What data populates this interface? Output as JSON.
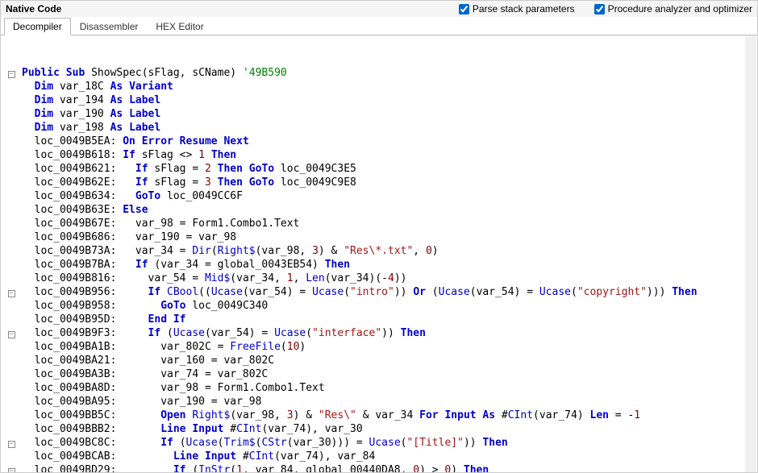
{
  "header": {
    "title": "Native Code",
    "checkboxes": [
      {
        "label": "Parse stack parameters",
        "checked": true
      },
      {
        "label": "Procedure analyzer and optimizer",
        "checked": true
      }
    ]
  },
  "tabs": [
    {
      "label": "Decompiler",
      "active": true
    },
    {
      "label": "Disassembler",
      "active": false
    },
    {
      "label": "HEX Editor",
      "active": false
    }
  ],
  "code": [
    {
      "fold": "minus",
      "indent": 0,
      "tokens": [
        [
          "k-blue",
          "Public Sub "
        ],
        [
          "k-plain",
          "ShowSpec(sFlag, sCName) "
        ],
        [
          "k-cmt",
          "'49B590"
        ]
      ]
    },
    {
      "indent": 1,
      "tokens": [
        [
          "k-blue",
          "Dim "
        ],
        [
          "k-plain",
          "var_18C "
        ],
        [
          "k-blue",
          "As Variant"
        ]
      ]
    },
    {
      "indent": 1,
      "tokens": [
        [
          "k-blue",
          "Dim "
        ],
        [
          "k-plain",
          "var_194 "
        ],
        [
          "k-blue",
          "As Label"
        ]
      ]
    },
    {
      "indent": 1,
      "tokens": [
        [
          "k-blue",
          "Dim "
        ],
        [
          "k-plain",
          "var_190 "
        ],
        [
          "k-blue",
          "As Label"
        ]
      ]
    },
    {
      "indent": 1,
      "tokens": [
        [
          "k-blue",
          "Dim "
        ],
        [
          "k-plain",
          "var_198 "
        ],
        [
          "k-blue",
          "As Label"
        ]
      ]
    },
    {
      "indent": 1,
      "tokens": [
        [
          "k-plain",
          "loc_0049B5EA: "
        ],
        [
          "k-blue",
          "On Error Resume Next"
        ]
      ]
    },
    {
      "indent": 1,
      "tokens": [
        [
          "k-plain",
          "loc_0049B618: "
        ],
        [
          "k-blue",
          "If "
        ],
        [
          "k-plain",
          "sFlag <> "
        ],
        [
          "k-num",
          "1"
        ],
        [
          "k-blue",
          " Then"
        ]
      ]
    },
    {
      "indent": 1,
      "tokens": [
        [
          "k-plain",
          "loc_0049B621:   "
        ],
        [
          "k-blue",
          "If "
        ],
        [
          "k-plain",
          "sFlag = "
        ],
        [
          "k-num",
          "2"
        ],
        [
          "k-blue",
          " Then GoTo "
        ],
        [
          "k-plain",
          "loc_0049C3E5"
        ]
      ]
    },
    {
      "indent": 1,
      "tokens": [
        [
          "k-plain",
          "loc_0049B62E:   "
        ],
        [
          "k-blue",
          "If "
        ],
        [
          "k-plain",
          "sFlag = "
        ],
        [
          "k-num",
          "3"
        ],
        [
          "k-blue",
          " Then GoTo "
        ],
        [
          "k-plain",
          "loc_0049C9E8"
        ]
      ]
    },
    {
      "indent": 1,
      "tokens": [
        [
          "k-plain",
          "loc_0049B634:   "
        ],
        [
          "k-blue",
          "GoTo "
        ],
        [
          "k-plain",
          "loc_0049CC6F"
        ]
      ]
    },
    {
      "indent": 1,
      "tokens": [
        [
          "k-plain",
          "loc_0049B63E: "
        ],
        [
          "k-blue",
          "Else"
        ]
      ]
    },
    {
      "indent": 1,
      "tokens": [
        [
          "k-plain",
          "loc_0049B67E:   var_98 = Form1.Combo1.Text"
        ]
      ]
    },
    {
      "indent": 1,
      "tokens": [
        [
          "k-plain",
          "loc_0049B686:   var_190 = var_98"
        ]
      ]
    },
    {
      "indent": 1,
      "tokens": [
        [
          "k-plain",
          "loc_0049B73A:   var_34 = "
        ],
        [
          "k-bluep",
          "Dir"
        ],
        [
          "k-plain",
          "("
        ],
        [
          "k-bluep",
          "Right$"
        ],
        [
          "k-plain",
          "(var_98, "
        ],
        [
          "k-num",
          "3"
        ],
        [
          "k-plain",
          ") & "
        ],
        [
          "k-str",
          "\"Res\\*.txt\""
        ],
        [
          "k-plain",
          ", "
        ],
        [
          "k-num",
          "0"
        ],
        [
          "k-plain",
          ")"
        ]
      ]
    },
    {
      "indent": 1,
      "tokens": [
        [
          "k-plain",
          "loc_0049B7BA:   "
        ],
        [
          "k-blue",
          "If "
        ],
        [
          "k-plain",
          "(var_34 = global_0043EB54) "
        ],
        [
          "k-blue",
          "Then"
        ]
      ]
    },
    {
      "indent": 1,
      "tokens": [
        [
          "k-plain",
          "loc_0049B816:     var_54 = "
        ],
        [
          "k-bluep",
          "Mid$"
        ],
        [
          "k-plain",
          "(var_34, "
        ],
        [
          "k-num",
          "1"
        ],
        [
          "k-plain",
          ", "
        ],
        [
          "k-bluep",
          "Len"
        ],
        [
          "k-plain",
          "(var_34)(-"
        ],
        [
          "k-num",
          "4"
        ],
        [
          "k-plain",
          "))"
        ]
      ]
    },
    {
      "fold": "minus",
      "indent": 1,
      "tokens": [
        [
          "k-plain",
          "loc_0049B956:     "
        ],
        [
          "k-blue",
          "If "
        ],
        [
          "k-bluep",
          "CBool"
        ],
        [
          "k-plain",
          "(("
        ],
        [
          "k-bluep",
          "Ucase"
        ],
        [
          "k-plain",
          "(var_54) = "
        ],
        [
          "k-bluep",
          "Ucase"
        ],
        [
          "k-plain",
          "("
        ],
        [
          "k-str",
          "\"intro\""
        ],
        [
          "k-plain",
          ")) "
        ],
        [
          "k-blue",
          "Or "
        ],
        [
          "k-plain",
          "("
        ],
        [
          "k-bluep",
          "Ucase"
        ],
        [
          "k-plain",
          "(var_54) = "
        ],
        [
          "k-bluep",
          "Ucase"
        ],
        [
          "k-plain",
          "("
        ],
        [
          "k-str",
          "\"copyright\""
        ],
        [
          "k-plain",
          "))) "
        ],
        [
          "k-blue",
          "Then"
        ]
      ]
    },
    {
      "indent": 1,
      "tokens": [
        [
          "k-plain",
          "loc_0049B958:       "
        ],
        [
          "k-blue",
          "GoTo "
        ],
        [
          "k-plain",
          "loc_0049C340"
        ]
      ]
    },
    {
      "indent": 1,
      "tokens": [
        [
          "k-plain",
          "loc_0049B95D:     "
        ],
        [
          "k-blue",
          "End If"
        ]
      ]
    },
    {
      "fold": "minus",
      "indent": 1,
      "tokens": [
        [
          "k-plain",
          "loc_0049B9F3:     "
        ],
        [
          "k-blue",
          "If "
        ],
        [
          "k-plain",
          "("
        ],
        [
          "k-bluep",
          "Ucase"
        ],
        [
          "k-plain",
          "(var_54) = "
        ],
        [
          "k-bluep",
          "Ucase"
        ],
        [
          "k-plain",
          "("
        ],
        [
          "k-str",
          "\"interface\""
        ],
        [
          "k-plain",
          ")) "
        ],
        [
          "k-blue",
          "Then"
        ]
      ]
    },
    {
      "indent": 1,
      "tokens": [
        [
          "k-plain",
          "loc_0049BA1B:       var_802C = "
        ],
        [
          "k-bluep",
          "FreeFile"
        ],
        [
          "k-plain",
          "("
        ],
        [
          "k-num",
          "10"
        ],
        [
          "k-plain",
          ")"
        ]
      ]
    },
    {
      "indent": 1,
      "tokens": [
        [
          "k-plain",
          "loc_0049BA21:       var_160 = var_802C"
        ]
      ]
    },
    {
      "indent": 1,
      "tokens": [
        [
          "k-plain",
          "loc_0049BA3B:       var_74 = var_802C"
        ]
      ]
    },
    {
      "indent": 1,
      "tokens": [
        [
          "k-plain",
          "loc_0049BA8D:       var_98 = Form1.Combo1.Text"
        ]
      ]
    },
    {
      "indent": 1,
      "tokens": [
        [
          "k-plain",
          "loc_0049BA95:       var_190 = var_98"
        ]
      ]
    },
    {
      "indent": 1,
      "tokens": [
        [
          "k-plain",
          "loc_0049BB5C:       "
        ],
        [
          "k-blue",
          "Open "
        ],
        [
          "k-bluep",
          "Right$"
        ],
        [
          "k-plain",
          "(var_98, "
        ],
        [
          "k-num",
          "3"
        ],
        [
          "k-plain",
          ") & "
        ],
        [
          "k-str",
          "\"Res\\\""
        ],
        [
          "k-plain",
          " & var_34 "
        ],
        [
          "k-blue",
          "For Input As "
        ],
        [
          "k-plain",
          "#"
        ],
        [
          "k-bluep",
          "CInt"
        ],
        [
          "k-plain",
          "(var_74) "
        ],
        [
          "k-blue",
          "Len"
        ],
        [
          "k-plain",
          " = -"
        ],
        [
          "k-num",
          "1"
        ]
      ]
    },
    {
      "indent": 1,
      "tokens": [
        [
          "k-plain",
          "loc_0049BBB2:       "
        ],
        [
          "k-blue",
          "Line Input "
        ],
        [
          "k-plain",
          "#"
        ],
        [
          "k-bluep",
          "CInt"
        ],
        [
          "k-plain",
          "(var_74), var_30"
        ]
      ]
    },
    {
      "fold": "minus",
      "indent": 1,
      "tokens": [
        [
          "k-plain",
          "loc_0049BC8C:       "
        ],
        [
          "k-blue",
          "If "
        ],
        [
          "k-plain",
          "("
        ],
        [
          "k-bluep",
          "Ucase"
        ],
        [
          "k-plain",
          "("
        ],
        [
          "k-bluep",
          "Trim$"
        ],
        [
          "k-plain",
          "("
        ],
        [
          "k-bluep",
          "CStr"
        ],
        [
          "k-plain",
          "(var_30))) = "
        ],
        [
          "k-bluep",
          "Ucase"
        ],
        [
          "k-plain",
          "("
        ],
        [
          "k-str",
          "\"[Title]\""
        ],
        [
          "k-plain",
          ")) "
        ],
        [
          "k-blue",
          "Then"
        ]
      ]
    },
    {
      "indent": 1,
      "tokens": [
        [
          "k-plain",
          "loc_0049BCAB:         "
        ],
        [
          "k-blue",
          "Line Input "
        ],
        [
          "k-plain",
          "#"
        ],
        [
          "k-bluep",
          "CInt"
        ],
        [
          "k-plain",
          "(var_74), var_84"
        ]
      ]
    },
    {
      "fold": "minus",
      "indent": 1,
      "tokens": [
        [
          "k-plain",
          "loc_0049BD29:         "
        ],
        [
          "k-blue",
          "If "
        ],
        [
          "k-plain",
          "("
        ],
        [
          "k-bluep",
          "InStr"
        ],
        [
          "k-plain",
          "("
        ],
        [
          "k-num",
          "1"
        ],
        [
          "k-plain",
          ", var_84, global_00440DA8, "
        ],
        [
          "k-num",
          "0"
        ],
        [
          "k-plain",
          ") > "
        ],
        [
          "k-num",
          "0"
        ],
        [
          "k-plain",
          ") "
        ],
        [
          "k-blue",
          "Then"
        ]
      ]
    }
  ]
}
